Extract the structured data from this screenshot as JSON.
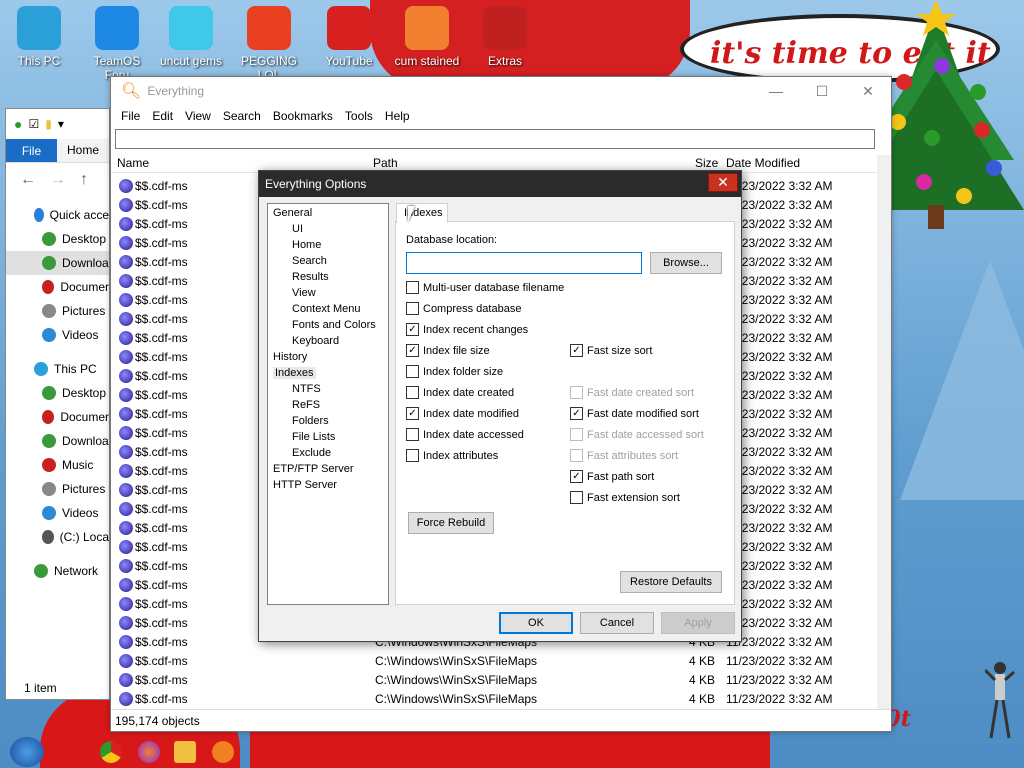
{
  "desktop": {
    "icons": [
      {
        "label": "This PC",
        "icon": "computer-icon",
        "color": "#2a9fd8"
      },
      {
        "label": "TeamOS Foru",
        "icon": "gear-icon",
        "color": "#1e88e5"
      },
      {
        "label": "uncut gems",
        "icon": "diamond-icon",
        "color": "#40c8e8"
      },
      {
        "label": "PEGGING LOL",
        "icon": "p-logo-icon",
        "color": "#e84020"
      },
      {
        "label": "YouTube",
        "icon": "angry-bird-icon",
        "color": "#d82020"
      },
      {
        "label": "cum stained",
        "icon": "cake-icon",
        "color": "#f08030"
      },
      {
        "label": "Extras",
        "icon": "gift-icon",
        "color": "#c02020"
      }
    ],
    "speech_bubble": "it's time to eat it",
    "bottom_text": "b0t"
  },
  "explorer": {
    "tabs": {
      "file": "File",
      "home": "Home"
    },
    "nav_items": [
      {
        "label": "Quick acce",
        "icon": "star-icon",
        "color": "#2a7fd8"
      },
      {
        "label": "Desktop",
        "icon": "desktop-icon",
        "color": "#3a9a3a"
      },
      {
        "label": "Downloa",
        "icon": "download-icon",
        "color": "#3a9a3a",
        "selected": true
      },
      {
        "label": "Documer",
        "icon": "document-icon",
        "color": "#c82020"
      },
      {
        "label": "Pictures",
        "icon": "pictures-icon",
        "color": "#888888"
      },
      {
        "label": "Videos",
        "icon": "videos-icon",
        "color": "#2a8ad8"
      },
      {
        "label": "This PC",
        "icon": "computer-icon",
        "color": "#2a9fd8"
      },
      {
        "label": "Desktop",
        "icon": "desktop-icon",
        "color": "#3a9a3a"
      },
      {
        "label": "Documer",
        "icon": "document-icon",
        "color": "#c82020"
      },
      {
        "label": "Downloa",
        "icon": "download-icon",
        "color": "#3a9a3a"
      },
      {
        "label": "Music",
        "icon": "music-icon",
        "color": "#c82020"
      },
      {
        "label": "Pictures",
        "icon": "pictures-icon",
        "color": "#888888"
      },
      {
        "label": "Videos",
        "icon": "videos-icon",
        "color": "#2a8ad8"
      },
      {
        "label": "(C:) Loca",
        "icon": "drive-icon",
        "color": "#555555"
      },
      {
        "label": "Network",
        "icon": "network-icon",
        "color": "#3a9a3a"
      }
    ],
    "status": "1 item"
  },
  "everything": {
    "title": "Everything",
    "menu": [
      "File",
      "Edit",
      "View",
      "Search",
      "Bookmarks",
      "Tools",
      "Help"
    ],
    "columns": {
      "name": "Name",
      "path": "Path",
      "size": "Size",
      "date": "Date Modified"
    },
    "rows": [
      {
        "name": "$$.cdf-ms",
        "path": "",
        "size": "",
        "date": "11/23/2022 3:32 AM"
      },
      {
        "name": "$$.cdf-ms",
        "path": "",
        "size": "",
        "date": "11/23/2022 3:32 AM"
      },
      {
        "name": "$$.cdf-ms",
        "path": "",
        "size": "",
        "date": "11/23/2022 3:32 AM"
      },
      {
        "name": "$$.cdf-ms",
        "path": "",
        "size": "",
        "date": "11/23/2022 3:32 AM"
      },
      {
        "name": "$$.cdf-ms",
        "path": "",
        "size": "",
        "date": "11/23/2022 3:32 AM"
      },
      {
        "name": "$$.cdf-ms",
        "path": "",
        "size": "",
        "date": "11/23/2022 3:32 AM"
      },
      {
        "name": "$$.cdf-ms",
        "path": "",
        "size": "",
        "date": "11/23/2022 3:32 AM"
      },
      {
        "name": "$$.cdf-ms",
        "path": "",
        "size": "",
        "date": "11/23/2022 3:32 AM"
      },
      {
        "name": "$$.cdf-ms",
        "path": "",
        "size": "",
        "date": "11/23/2022 3:32 AM"
      },
      {
        "name": "$$.cdf-ms",
        "path": "",
        "size": "",
        "date": "11/23/2022 3:32 AM"
      },
      {
        "name": "$$.cdf-ms",
        "path": "",
        "size": "",
        "date": "11/23/2022 3:32 AM"
      },
      {
        "name": "$$.cdf-ms",
        "path": "",
        "size": "",
        "date": "11/23/2022 3:32 AM"
      },
      {
        "name": "$$.cdf-ms",
        "path": "",
        "size": "",
        "date": "11/23/2022 3:32 AM"
      },
      {
        "name": "$$.cdf-ms",
        "path": "",
        "size": "",
        "date": "11/23/2022 3:32 AM"
      },
      {
        "name": "$$.cdf-ms",
        "path": "",
        "size": "",
        "date": "11/23/2022 3:32 AM"
      },
      {
        "name": "$$.cdf-ms",
        "path": "",
        "size": "",
        "date": "11/23/2022 3:32 AM"
      },
      {
        "name": "$$.cdf-ms",
        "path": "",
        "size": "",
        "date": "11/23/2022 3:32 AM"
      },
      {
        "name": "$$.cdf-ms",
        "path": "",
        "size": "",
        "date": "11/23/2022 3:32 AM"
      },
      {
        "name": "$$.cdf-ms",
        "path": "",
        "size": "",
        "date": "11/23/2022 3:32 AM"
      },
      {
        "name": "$$.cdf-ms",
        "path": "",
        "size": "",
        "date": "11/23/2022 3:32 AM"
      },
      {
        "name": "$$.cdf-ms",
        "path": "",
        "size": "",
        "date": "11/23/2022 3:32 AM"
      },
      {
        "name": "$$.cdf-ms",
        "path": "",
        "size": "",
        "date": "11/23/2022 3:32 AM"
      },
      {
        "name": "$$.cdf-ms",
        "path": "",
        "size": "",
        "date": "11/23/2022 3:32 AM"
      },
      {
        "name": "$$.cdf-ms",
        "path": "",
        "size": "",
        "date": "11/23/2022 3:32 AM"
      },
      {
        "name": "$$.cdf-ms",
        "path": "C:\\Windows\\WinSxS\\FileMaps",
        "size": "4 KB",
        "date": "11/23/2022 3:32 AM"
      },
      {
        "name": "$$.cdf-ms",
        "path": "C:\\Windows\\WinSxS\\FileMaps",
        "size": "4 KB",
        "date": "11/23/2022 3:32 AM"
      },
      {
        "name": "$$.cdf-ms",
        "path": "C:\\Windows\\WinSxS\\FileMaps",
        "size": "4 KB",
        "date": "11/23/2022 3:32 AM"
      },
      {
        "name": "$$.cdf-ms",
        "path": "C:\\Windows\\WinSxS\\FileMaps",
        "size": "4 KB",
        "date": "11/23/2022 3:32 AM"
      }
    ],
    "status": "195,174 objects"
  },
  "options": {
    "title": "Everything Options",
    "close_glyph": "✕",
    "tree": [
      {
        "label": "General",
        "level": 0
      },
      {
        "label": "UI",
        "level": 1
      },
      {
        "label": "Home",
        "level": 1
      },
      {
        "label": "Search",
        "level": 1
      },
      {
        "label": "Results",
        "level": 1
      },
      {
        "label": "View",
        "level": 1
      },
      {
        "label": "Context Menu",
        "level": 1
      },
      {
        "label": "Fonts and Colors",
        "level": 1
      },
      {
        "label": "Keyboard",
        "level": 1
      },
      {
        "label": "History",
        "level": 0
      },
      {
        "label": "Indexes",
        "level": 0,
        "selected": true
      },
      {
        "label": "NTFS",
        "level": 1
      },
      {
        "label": "ReFS",
        "level": 1
      },
      {
        "label": "Folders",
        "level": 1
      },
      {
        "label": "File Lists",
        "level": 1
      },
      {
        "label": "Exclude",
        "level": 1
      },
      {
        "label": "ETP/FTP Server",
        "level": 0
      },
      {
        "label": "HTTP Server",
        "level": 0
      }
    ],
    "tab_label": "Indexes",
    "db_location_label": "Database location:",
    "db_location_value": "",
    "browse_label": "Browse...",
    "checkboxes_left": [
      {
        "label": "Multi-user database filename",
        "checked": false,
        "disabled": false
      },
      {
        "label": "Compress database",
        "checked": false,
        "disabled": false
      },
      {
        "label": "Index recent changes",
        "checked": true,
        "disabled": false
      },
      {
        "label": "Index file size",
        "checked": true,
        "disabled": false
      },
      {
        "label": "Index folder size",
        "checked": false,
        "disabled": false
      },
      {
        "label": "Index date created",
        "checked": false,
        "disabled": false
      },
      {
        "label": "Index date modified",
        "checked": true,
        "disabled": false
      },
      {
        "label": "Index date accessed",
        "checked": false,
        "disabled": false
      },
      {
        "label": "Index attributes",
        "checked": false,
        "disabled": false
      }
    ],
    "checkboxes_right": [
      {
        "label": "Fast size sort",
        "checked": true,
        "disabled": false
      },
      {
        "label": "Fast date created sort",
        "checked": false,
        "disabled": true
      },
      {
        "label": "Fast date modified sort",
        "checked": true,
        "disabled": false
      },
      {
        "label": "Fast date accessed sort",
        "checked": false,
        "disabled": true
      },
      {
        "label": "Fast attributes sort",
        "checked": false,
        "disabled": true
      },
      {
        "label": "Fast path sort",
        "checked": true,
        "disabled": false
      },
      {
        "label": "Fast extension sort",
        "checked": false,
        "disabled": false
      }
    ],
    "force_rebuild": "Force Rebuild",
    "restore_defaults": "Restore Defaults",
    "ok": "OK",
    "cancel": "Cancel",
    "apply": "Apply"
  }
}
